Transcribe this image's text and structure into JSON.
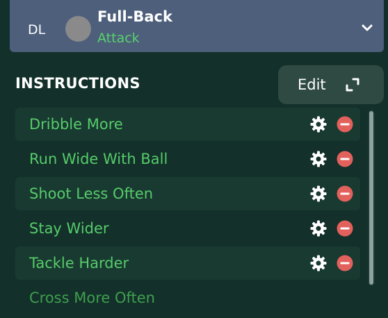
{
  "role_card": {
    "position_code": "DL",
    "role": "Full-Back",
    "duty": "Attack",
    "expand_icon": "chevron-down-icon"
  },
  "instructions": {
    "title": "INSTRUCTIONS",
    "edit_label": "Edit",
    "edit_icon": "expand-icon",
    "items": [
      {
        "label": "Dribble More",
        "gear_icon": "gear-icon",
        "remove_icon": "remove-icon"
      },
      {
        "label": "Run Wide With Ball",
        "gear_icon": "gear-icon",
        "remove_icon": "remove-icon"
      },
      {
        "label": "Shoot Less Often",
        "gear_icon": "gear-icon",
        "remove_icon": "remove-icon"
      },
      {
        "label": "Stay Wider",
        "gear_icon": "gear-icon",
        "remove_icon": "remove-icon"
      },
      {
        "label": "Tackle Harder",
        "gear_icon": "gear-icon",
        "remove_icon": "remove-icon"
      },
      {
        "label": "Cross More Often"
      }
    ]
  },
  "colors": {
    "background": "#13302a",
    "card": "#4d5f7b",
    "accent_green": "#56cc6a",
    "remove_red": "#e2615c",
    "row_band": "#193a31"
  }
}
